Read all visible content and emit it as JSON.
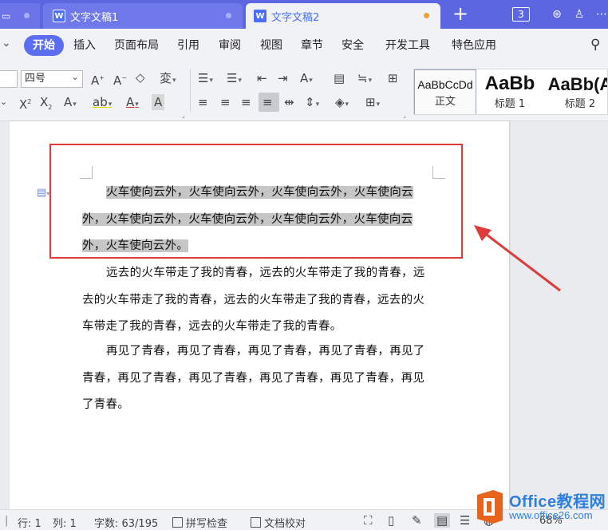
{
  "tabs": {
    "doc1": "文字文稿1",
    "doc2": "文字文稿2",
    "new_tab": "+",
    "count": "3"
  },
  "menu": {
    "items": [
      "开始",
      "插入",
      "页面布局",
      "引用",
      "审阅",
      "视图",
      "章节",
      "安全",
      "开发工具",
      "特色应用"
    ]
  },
  "toolbar": {
    "font_size": "四号",
    "styles": [
      {
        "preview": "AaBbCcDd",
        "name": "正文"
      },
      {
        "preview": "AaBb",
        "name": "标题 1"
      },
      {
        "preview": "AaBb(A",
        "name": "标题 2"
      }
    ]
  },
  "document": {
    "paragraphs": [
      {
        "text": "火车使向云外，火车使向云外，火车使向云外，火车使向云外，火车使向云外，火车使向云外，火车使向云外，火车使向云外，火车使向云外。",
        "selected": true
      },
      {
        "text": "远去的火车带走了我的青春，远去的火车带走了我的青春，远去的火车带走了我的青春，远去的火车带走了我的青春，远去的火车带走了我的青春，远去的火车带走了我的青春。",
        "selected": false
      },
      {
        "text": "再见了青春，再见了青春，再见了青春，再见了青春，再见了青春，再见了青春，再见了青春，再见了青春，再见了青春，再见了青春。",
        "selected": false
      }
    ]
  },
  "status": {
    "row": "行: 1",
    "col": "列: 1",
    "word_count": "字数: 63/195",
    "spellcheck": "拼写检查",
    "proofread": "文档校对",
    "zoom": "68%"
  },
  "watermark": {
    "title": "Office教程网",
    "url": "www.office26.com"
  },
  "colors": {
    "titlebar": "#5b66e0",
    "accent": "#5b6ef0",
    "highlight_box": "#e03b3b",
    "selection": "#c6c6c6"
  }
}
